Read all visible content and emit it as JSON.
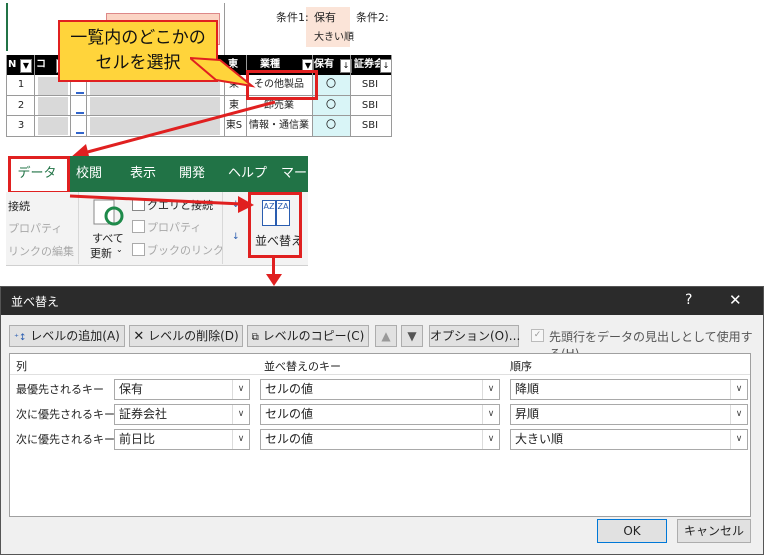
{
  "sheet": {
    "cond1_label": "条件1:",
    "cond1_value1": "保有",
    "cond1_value2": "大きい順",
    "cond2_label": "条件2:",
    "headers": [
      "N",
      "コ",
      "",
      "",
      "東",
      "業種",
      "保有",
      "証券会"
    ],
    "rows": [
      {
        "no": "1",
        "mkt": "東",
        "industry": "その他製品",
        "hold": "〇",
        "broker": "SBI"
      },
      {
        "no": "2",
        "mkt": "東",
        "industry": "卸売業",
        "hold": "〇",
        "broker": "SBI"
      },
      {
        "no": "3",
        "mkt": "東S",
        "industry": "情報・通信業",
        "hold": "〇",
        "broker": "SBI"
      }
    ]
  },
  "callout": {
    "line1": "一覧内のどこかの",
    "line2": "セルを選択"
  },
  "ribbon": {
    "tabs": [
      "データ",
      "校閲",
      "表示",
      "開発",
      "ヘルプ",
      "マーク"
    ],
    "connect": "接続",
    "properties": "プロパティ",
    "edit_links": "リンクの編集",
    "refresh_all_1": "すべて",
    "refresh_all_2": "更新",
    "query_connect": "クエリと接続",
    "properties2": "プロパティ",
    "workbook_links": "ブックのリンク",
    "sort": "並べ替え",
    "sort_az_icon": "AZ",
    "sort_za_icon": "ZA"
  },
  "dialog": {
    "title": "並べ替え",
    "help": "?",
    "close": "✕",
    "add_level": "レベルの追加(A)",
    "delete_level": "レベルの削除(D)",
    "copy_level": "レベルのコピー(C)",
    "options": "オプション(O)...",
    "header_checkbox": "先頭行をデータの見出しとして使用する(H)",
    "col_header": "列",
    "key_header": "並べ替えのキー",
    "order_header": "順序",
    "levels": [
      {
        "label": "最優先されるキー",
        "column": "保有",
        "key": "セルの値",
        "order": "降順"
      },
      {
        "label": "次に優先されるキー",
        "column": "証券会社",
        "key": "セルの値",
        "order": "昇順"
      },
      {
        "label": "次に優先されるキー",
        "column": "前日比",
        "key": "セルの値",
        "order": "大きい順"
      }
    ],
    "ok": "OK",
    "cancel": "キャンセル"
  }
}
